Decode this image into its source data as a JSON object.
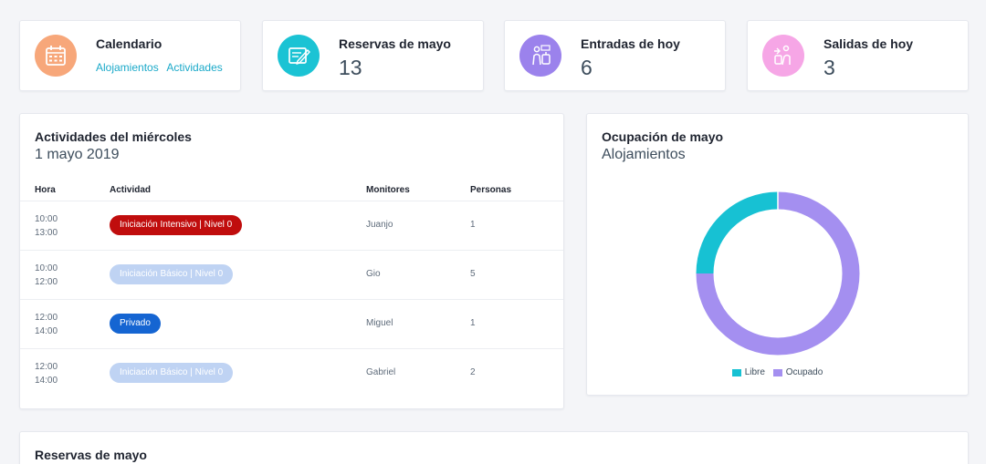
{
  "stats": [
    {
      "title": "Calendario",
      "links": [
        "Alojamientos",
        "Actividades"
      ],
      "icon": "calendar-icon",
      "color": "#f7a77a"
    },
    {
      "title": "Reservas de mayo",
      "value": "13",
      "icon": "booking-icon",
      "color": "#1bc3d4"
    },
    {
      "title": "Entradas de hoy",
      "value": "6",
      "icon": "check-in-icon",
      "color": "#9b82ec"
    },
    {
      "title": "Salidas de hoy",
      "value": "3",
      "icon": "check-out-icon",
      "color": "#f6a6e6"
    }
  ],
  "activities": {
    "title": "Actividades del miércoles",
    "date": "1 mayo 2019",
    "columns": [
      "Hora",
      "Actividad",
      "Monitores",
      "Personas"
    ],
    "rows": [
      {
        "start": "10:00",
        "end": "13:00",
        "activity": "Iniciación Intensivo | Nivel 0",
        "monitor": "Juanjo",
        "people": "1",
        "pill_bg": "#c00d0d",
        "pill_fg": "#ffffff"
      },
      {
        "start": "10:00",
        "end": "12:00",
        "activity": "Iniciación Básico | Nivel 0",
        "monitor": "Gio",
        "people": "5",
        "pill_bg": "#bfd3f3",
        "pill_fg": "#ffffff"
      },
      {
        "start": "12:00",
        "end": "14:00",
        "activity": "Privado",
        "monitor": "Miguel",
        "people": "1",
        "pill_bg": "#1565d2",
        "pill_fg": "#ffffff"
      },
      {
        "start": "12:00",
        "end": "14:00",
        "activity": "Iniciación Básico | Nivel 0",
        "monitor": "Gabriel",
        "people": "2",
        "pill_bg": "#bfd3f3",
        "pill_fg": "#ffffff"
      }
    ]
  },
  "occupancy": {
    "title": "Ocupación de mayo",
    "subtitle": "Alojamientos"
  },
  "chart_data": {
    "type": "pie",
    "donut": true,
    "categories": [
      "Libre",
      "Ocupado"
    ],
    "values": [
      25,
      75
    ],
    "colors": [
      "#17c1d3",
      "#a48ff0"
    ],
    "legend": "bottom"
  },
  "bookings": {
    "title": "Reservas de mayo"
  }
}
